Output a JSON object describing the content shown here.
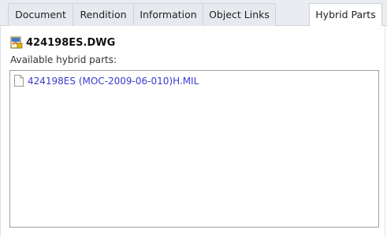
{
  "tabs": [
    {
      "label": "Document"
    },
    {
      "label": "Rendition"
    },
    {
      "label": "Information"
    },
    {
      "label": "Object Links"
    },
    {
      "label": "Hybrid Parts",
      "active": true
    }
  ],
  "file": {
    "name": "424198ES.DWG",
    "icon": "dwg-file-icon"
  },
  "hybrid_parts": {
    "caption": "Available hybrid parts:",
    "items": [
      {
        "label": "424198ES (MOC-2009-06-010)H.MIL",
        "icon": "document-icon"
      }
    ]
  },
  "colors": {
    "link": "#3b3bd1",
    "tab_bg": "#e6e9ee",
    "active_tab_bg": "#ffffff"
  }
}
